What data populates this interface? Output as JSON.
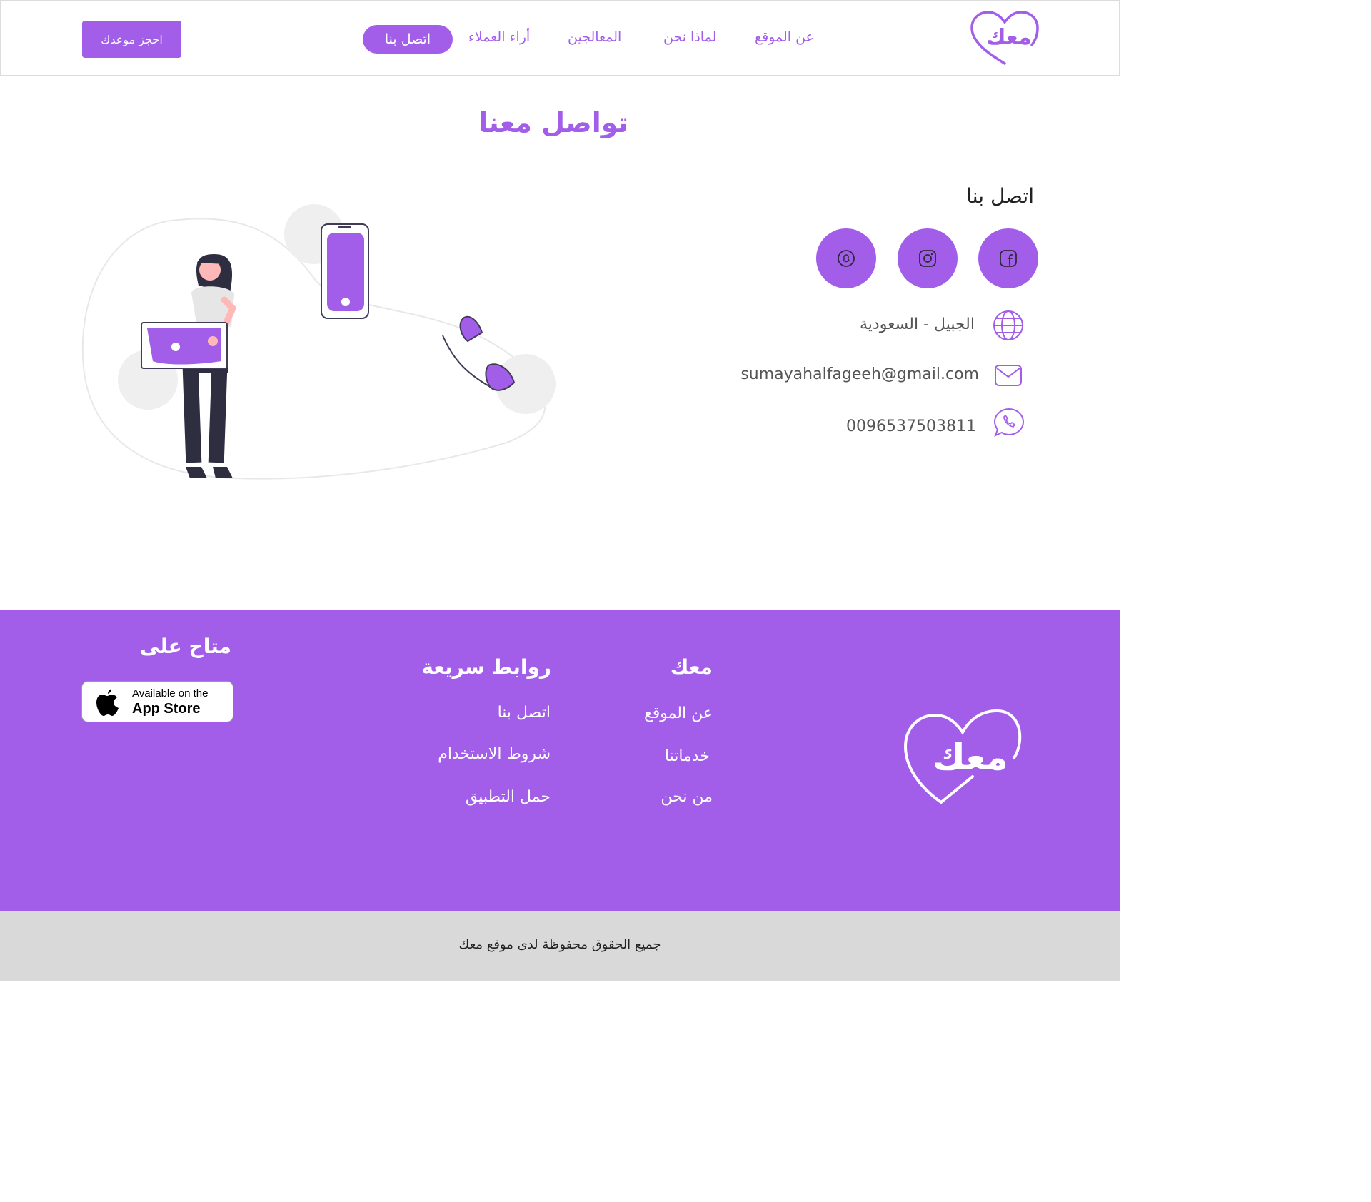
{
  "brand": {
    "name": "معك",
    "accent_color": "#a25de9",
    "logo_icon": "heart-logo-icon"
  },
  "nav": {
    "items": [
      "عن الموقع",
      "لماذا نحن",
      "المعالجين",
      "أراء العملاء"
    ],
    "active": "اتصل بنا",
    "book_button": "احجز موعدك"
  },
  "main": {
    "title": "تواصل معنا",
    "contact_heading": "اتصل بنا",
    "socials": [
      "facebook-icon",
      "instagram-icon",
      "snapchat-icon"
    ],
    "location": "الجبيل - السعودية",
    "email": "sumayahalfageeh@gmail.com",
    "phone": "0096537503811"
  },
  "footer": {
    "col1": {
      "heading": "معك",
      "links": [
        "عن الموقع",
        "خدماتنا",
        "من نحن"
      ]
    },
    "col2": {
      "heading": "روابط سريعة",
      "links": [
        "اتصل بنا",
        "شروط الاستخدام",
        "حمل التطبيق"
      ]
    },
    "col3": {
      "heading": "متاح على",
      "badge_small": "Available on the",
      "badge_big": "App Store"
    },
    "copyright": "جميع الحقوق محفوظة لدى موقع معك"
  }
}
